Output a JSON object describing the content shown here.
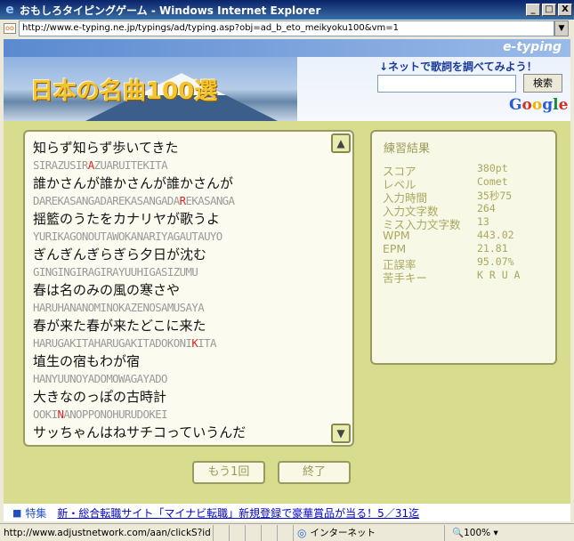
{
  "window": {
    "title": "おもしろタイピングゲーム - Windows Internet Explorer",
    "min": "_",
    "max": "□",
    "close": "X"
  },
  "address": {
    "url": "http://www.e-typing.ne.jp/typings/ad/typing.asp?obj=ad_b_eto_meikyoku100&vm=1"
  },
  "banner": {
    "brand": "e-typing",
    "title": "日本の名曲100選",
    "search_label": "↓ネットで歌詞を調べてみよう！",
    "search_value": "",
    "search_button": "検索",
    "google": [
      "G",
      "o",
      "o",
      "g",
      "l",
      "e"
    ]
  },
  "lyrics": [
    {
      "jp": "知らず知らず歩いてきた",
      "ro_before": "SIRAZUSIR",
      "ro_err": "A",
      "ro_after": "ZUARUITEKITA"
    },
    {
      "jp": "誰かさんが誰かさんが誰かさんが",
      "ro_before": "DAREKASANGADAREKASANGADA",
      "ro_err": "R",
      "ro_after": "EKASANGA"
    },
    {
      "jp": "揺籃のうたをカナリヤが歌うよ",
      "ro_before": "YURIKAGONOUTAWOKANARIYAGAUTAUYO",
      "ro_err": "",
      "ro_after": ""
    },
    {
      "jp": "ぎんぎんぎらぎら夕日が沈む",
      "ro_before": "GINGINGIRAGIRAYUUHIGASIZUMU",
      "ro_err": "",
      "ro_after": ""
    },
    {
      "jp": "春は名のみの風の寒さや",
      "ro_before": "HARUHANANOMINOKAZENOSAMUSAYA",
      "ro_err": "",
      "ro_after": ""
    },
    {
      "jp": "春が来た春が来たどこに来た",
      "ro_before": "HARUGAKITAHARUGAKITADOKONI",
      "ro_err": "K",
      "ro_after": "ITA"
    },
    {
      "jp": "埴生の宿もわが宿",
      "ro_before": "HANYUUNOYADOMOWAGAYADO",
      "ro_err": "",
      "ro_after": ""
    },
    {
      "jp": "大きなのっぽの古時計",
      "ro_before": "OOKI",
      "ro_err": "N",
      "ro_after": "ANOPPONOHURUDOKEI"
    },
    {
      "jp": "サッちゃんはねサチコっていうんだ",
      "ro_before": "",
      "ro_err": "",
      "ro_after": ""
    }
  ],
  "scroll": {
    "up": "▲",
    "down": "▼"
  },
  "results": {
    "title": "練習結果",
    "rows": [
      {
        "label": "スコア",
        "value": "380pt"
      },
      {
        "label": "レベル",
        "value": "Comet"
      },
      {
        "label": "入力時間",
        "value": "35秒75"
      },
      {
        "label": "入力文字数",
        "value": "264"
      },
      {
        "label": "ミス入力文字数",
        "value": "13"
      },
      {
        "label": "WPM",
        "value": "443.02"
      },
      {
        "label": "EPM",
        "value": "21.81"
      },
      {
        "label": "正誤率",
        "value": "95.07%"
      },
      {
        "label": "苦手キー",
        "value": "K R U A"
      }
    ]
  },
  "buttons": {
    "again": "もう1回",
    "finish": "終了"
  },
  "ad": {
    "square": "■",
    "tag": "特集",
    "text": "新・総合転職サイト「マイナビ転職」新規登録で豪華賞品が当る！5／31迄"
  },
  "status": {
    "url": "http://www.adjustnetwork.com/aan/clickS?id",
    "zone": "インターネット",
    "zoom": "100%"
  }
}
